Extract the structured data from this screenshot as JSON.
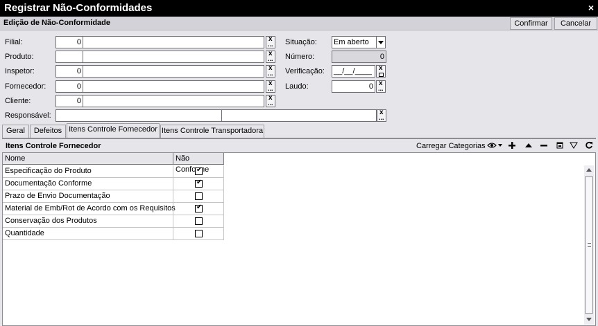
{
  "window": {
    "title": "Registrar Não-Conformidades",
    "close_glyph": "×"
  },
  "section": {
    "title": "Edição de Não-Conformidade",
    "confirm_label": "Confirmar",
    "cancel_label": "Cancelar"
  },
  "form": {
    "filial": {
      "label": "Filial:",
      "code": "0",
      "name": ""
    },
    "produto": {
      "label": "Produto:",
      "code": "",
      "name": ""
    },
    "inspetor": {
      "label": "Inspetor:",
      "code": "0",
      "name": ""
    },
    "fornecedor": {
      "label": "Fornecedor:",
      "code": "0",
      "name": ""
    },
    "cliente": {
      "label": "Cliente:",
      "code": "0",
      "name": ""
    },
    "responsavel": {
      "label": "Responsável:",
      "code": "",
      "name": ""
    },
    "situacao": {
      "label": "Situação:",
      "value": "Em aberto"
    },
    "numero": {
      "label": "Número:",
      "value": "0"
    },
    "verificacao": {
      "label": "Verificação:",
      "value": "__/__/____"
    },
    "laudo": {
      "label": "Laudo:",
      "value": "0"
    },
    "clear_glyph": "x",
    "lookup_glyph": "..."
  },
  "tabs": [
    {
      "label": "Geral"
    },
    {
      "label": "Defeitos"
    },
    {
      "label": "Itens Controle Fornecedor"
    },
    {
      "label": "Itens Controle Transportadora"
    }
  ],
  "content": {
    "title": "Itens Controle Fornecedor",
    "load_categories_label": "Carregar Categorias",
    "toolbar_icons": [
      "eye-icon",
      "plus-icon",
      "up-icon",
      "minus-icon",
      "window-icon",
      "filter-icon",
      "refresh-icon"
    ]
  },
  "grid": {
    "columns": [
      "Nome",
      "Não Conforme"
    ],
    "rows": [
      {
        "name": "Especificação do Produto",
        "checked": true
      },
      {
        "name": "Documentação Conforme",
        "checked": true
      },
      {
        "name": "Prazo de Envio Documentação",
        "checked": false
      },
      {
        "name": "Material de Emb/Rot de Acordo com os Requisitos",
        "checked": true
      },
      {
        "name": "Conservação dos Produtos",
        "checked": false
      },
      {
        "name": "Quantidade",
        "checked": false
      }
    ]
  },
  "colors": {
    "title_bg": "#000000",
    "panel_bg": "#e6e5ea",
    "section_bg": "#d3d2d8"
  }
}
